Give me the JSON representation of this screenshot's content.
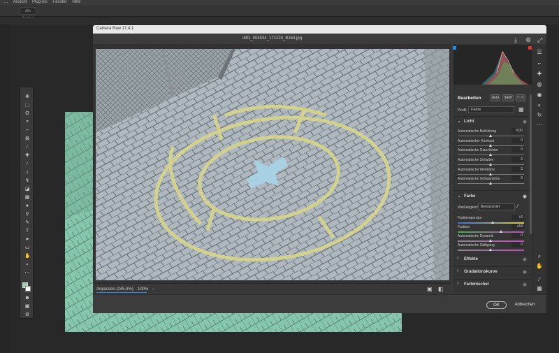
{
  "ps": {
    "menu": [
      "...",
      "Ansicht",
      "Plug-ins",
      "Fenster",
      "Hilfe"
    ],
    "options_button": "Alle löschen"
  },
  "dialog": {
    "title": "Camera Raw 17.4.1",
    "file_name": "IMG_004534_171223_B164.jpg",
    "zoom_label": "Anpassen (245,4%)",
    "zoom_percent": "100%",
    "ok": "OK",
    "cancel": "Abbrechen"
  },
  "edit_panel": {
    "title": "Bearbeiten",
    "buttons": [
      "Auto",
      "S&W",
      "HDR"
    ],
    "profile_label": "Profil",
    "profile_value": "Farbe",
    "licht": {
      "title": "Licht",
      "sliders": [
        {
          "label": "Automatische Belichtung",
          "value": "0,00",
          "level": 0.5
        },
        {
          "label": "Automatischer Kontrast",
          "value": "0",
          "level": 0.5
        },
        {
          "label": "Automatische Glanzlichter",
          "value": "0",
          "level": 0.5
        },
        {
          "label": "Automatische Schatten",
          "value": "0",
          "level": 0.5
        },
        {
          "label": "Automatische Weißtöne",
          "value": "0",
          "level": 0.5
        },
        {
          "label": "Automatische Schwarztöne",
          "value": "0",
          "level": 0.5
        }
      ]
    },
    "farbe": {
      "title": "Farbe",
      "wb_label": "Weißabgleich",
      "wb_value": "Benutzerdef.",
      "sliders": [
        {
          "label": "Farbtemperatur",
          "value": "+6",
          "level": 0.53
        },
        {
          "label": "Farbton",
          "value": "+64",
          "level": 0.66
        },
        {
          "label": "Automatische Dynamik",
          "value": "0",
          "level": 0.5
        },
        {
          "label": "Automatische Sättigung",
          "value": "0",
          "level": 0.5
        }
      ]
    },
    "sections": [
      "Effekte",
      "Gradationskurve",
      "Farbmischer"
    ]
  },
  "colors": {
    "accent": "#1e8ded",
    "photo_ground": "#a9b4ba",
    "paint": "#d7d68a",
    "bg_photo_tint": "#7fc4a6"
  }
}
